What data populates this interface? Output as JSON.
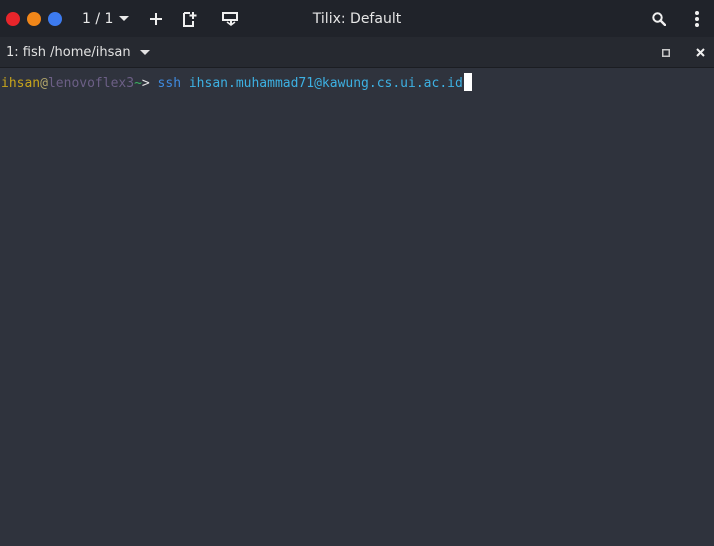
{
  "window": {
    "title": "Tilix: Default"
  },
  "header": {
    "session_counter": "1 / 1",
    "colors": {
      "close": "#e8252b",
      "minimize": "#f08619",
      "maximize": "#3d7bef"
    }
  },
  "terminal_tab": {
    "title": "1: fish /home/ihsan"
  },
  "terminal": {
    "prompt": {
      "user": "ihsan",
      "at": "@",
      "host": "lenovoflex3",
      "cwd": "~",
      "symbol": "> "
    },
    "command": {
      "name": "ssh",
      "space": " ",
      "argument": "ihsan.muhammad71@kawung.cs.ui.ac.id"
    }
  },
  "icons": {
    "add_session": "plus-icon",
    "add_terminal": "split-add-icon",
    "sync": "sync-icon",
    "search": "search-icon",
    "menu": "kebab-menu-icon",
    "maximize_terminal": "maximize-icon",
    "close_terminal": "close-icon"
  }
}
